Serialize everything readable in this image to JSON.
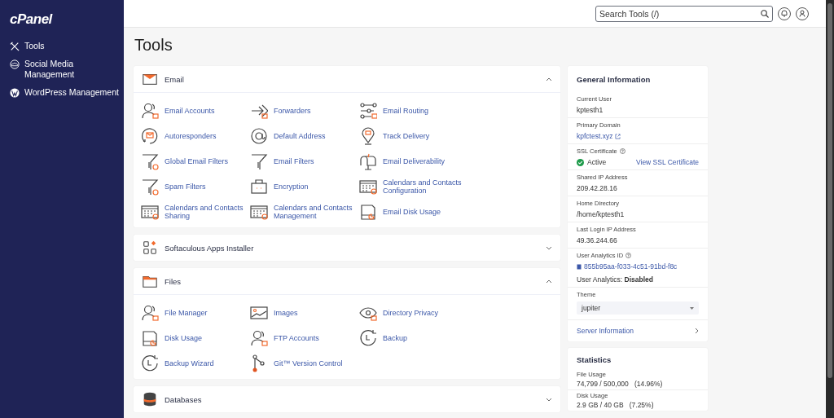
{
  "sidebar": {
    "logo": "cPanel",
    "items": [
      {
        "label": "Tools"
      },
      {
        "label": "Social Media Management"
      },
      {
        "label": "WordPress Management"
      }
    ]
  },
  "header": {
    "search": {
      "placeholder": "Search Tools (/)"
    }
  },
  "page_title": "Tools",
  "sections": [
    {
      "title": "Email",
      "expanded": true,
      "items": [
        "Email Accounts",
        "Forwarders",
        "Email Routing",
        "Autoresponders",
        "Default Address",
        "Track Delivery",
        "Global Email Filters",
        "Email Filters",
        "Email Deliverability",
        "Spam Filters",
        "Encryption",
        "Calendars and Contacts Configuration",
        "Calendars and Contacts Sharing",
        "Calendars and Contacts Management",
        "Email Disk Usage"
      ]
    },
    {
      "title": "Softaculous Apps Installer",
      "expanded": false
    },
    {
      "title": "Files",
      "expanded": true,
      "items": [
        "File Manager",
        "Images",
        "Directory Privacy",
        "Disk Usage",
        "FTP Accounts",
        "Backup",
        "Backup Wizard",
        "Git™ Version Control"
      ]
    },
    {
      "title": "Databases",
      "expanded": false
    }
  ],
  "general_information": {
    "title": "General Information",
    "current_user": {
      "label": "Current User",
      "value": "kptesth1"
    },
    "primary_domain": {
      "label": "Primary Domain",
      "value": "kpfctest.xyz"
    },
    "ssl_certificate": {
      "label": "SSL Certificate",
      "status": "Active",
      "link": "View SSL Certificate"
    },
    "shared_ip": {
      "label": "Shared IP Address",
      "value": "209.42.28.16"
    },
    "home_directory": {
      "label": "Home Directory",
      "value": "/home/kptesth1"
    },
    "last_login_ip": {
      "label": "Last Login IP Address",
      "value": "49.36.244.66"
    },
    "user_analytics_id": {
      "label": "User Analytics ID",
      "value": "855b95aa-f033-4c51-91bd-f8c",
      "status": "User Analytics: **Disabled**"
    },
    "theme": {
      "label": "Theme",
      "value": "jupiter"
    },
    "server_information": "Server Information"
  },
  "statistics": {
    "title": "Statistics",
    "rows": [
      {
        "label": "File Usage",
        "value": "74,799 / 500,000   (14.96%)"
      },
      {
        "label": "Disk Usage",
        "value": "2.9 GB / 40 GB   (7.25%)"
      }
    ]
  }
}
